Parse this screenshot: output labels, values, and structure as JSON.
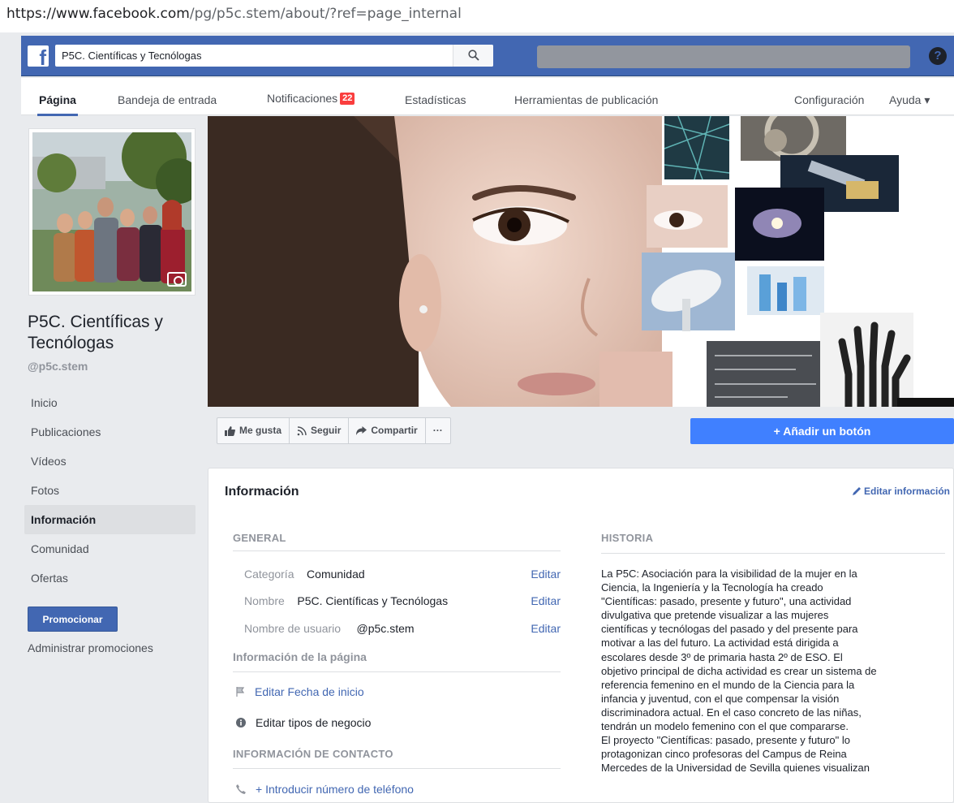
{
  "browser": {
    "url_host": "https://www.facebook.com",
    "url_path": "/pg/p5c.stem/about/?ref=page_internal"
  },
  "header": {
    "search_value": "P5C. Científicas y Tecnólogas",
    "help_label": "?"
  },
  "tabs": [
    {
      "label": "Página"
    },
    {
      "label": "Bandeja de entrada"
    },
    {
      "label": "Notificaciones",
      "badge": "22"
    },
    {
      "label": "Estadísticas"
    },
    {
      "label": "Herramientas de publicación"
    },
    {
      "label": "Configuración"
    },
    {
      "label": "Ayuda ▾"
    }
  ],
  "sidebar": {
    "page_name": "P5C. Científicas y Tecnólogas",
    "handle": "@p5c.stem",
    "nav": [
      "Inicio",
      "Publicaciones",
      "Vídeos",
      "Fotos",
      "Información",
      "Comunidad",
      "Ofertas"
    ],
    "active": "Información",
    "promote_label": "Promocionar",
    "manage_promotions": "Administrar promociones"
  },
  "actions": {
    "like": "Me gusta",
    "follow": "Seguir",
    "share": "Compartir",
    "more": "···",
    "add_button": "+ Añadir un botón"
  },
  "info": {
    "title": "Información",
    "edit_label": "Editar información",
    "general": {
      "heading": "GENERAL",
      "rows": [
        {
          "label": "Categoría",
          "value": "Comunidad",
          "edit": "Editar"
        },
        {
          "label": "Nombre",
          "value": "P5C. Científicas y Tecnólogas",
          "edit": "Editar"
        },
        {
          "label": "Nombre de usuario",
          "value": "@p5c.stem",
          "edit": "Editar"
        }
      ],
      "page_info_heading": "Información de la página",
      "start_date": "Editar Fecha de inicio",
      "business_types": "Editar tipos de negocio",
      "contact_heading": "INFORMACIÓN DE CONTACTO",
      "phone": "+ Introducir número de teléfono"
    },
    "story": {
      "heading": "HISTORIA",
      "text": "La P5C: Asociación para la visibilidad de la mujer en la\nCiencia, la Ingeniería y la Tecnología ha creado\n\"Científicas: pasado, presente y futuro\", una actividad\ndivulgativa que pretende visualizar a las mujeres\ncientíficas y tecnólogas del pasado y del presente para\nmotivar a las del futuro. La actividad está dirigida a\nescolares desde 3º de primaria hasta 2º de ESO. El\nobjetivo principal de dicha actividad es crear un sistema de\nreferencia femenino en el mundo de la Ciencia para la\ninfancia y juventud, con el que compensar la visión\ndiscriminadora actual. En el caso concreto de las niñas,\ntendrán un modelo femenino con el que compararse.\nEl proyecto \"Científicas: pasado, presente y futuro\" lo\nprotagonizan cinco profesoras del Campus de Reina\nMercedes de la Universidad de Sevilla quienes visualizan"
    }
  }
}
